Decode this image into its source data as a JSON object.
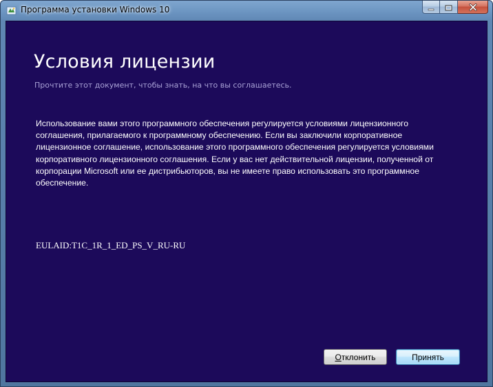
{
  "window": {
    "title": "Программа установки Windows 10"
  },
  "main": {
    "heading": "Условия лицензии",
    "subheading": "Прочтите этот документ, чтобы знать, на что вы соглашаетесь.",
    "license_lines": [
      "Использование вами этого программного обеспечения регулируется условиями лицензионного",
      "соглашения, прилагаемого к программному обеспечению. Если вы заключили корпоративное",
      "лицензионное соглашение, использование этого программного обеспечения регулируется условиями",
      "корпоративного лицензионного соглашения. Если у вас нет действительной лицензии, полученной от",
      "корпорации Microsoft или ее дистрибьюторов, вы не имеете право использовать это программное",
      "обеспечение."
    ],
    "eula_id": "EULAID:T1C_1R_1_ED_PS_V_RU-RU"
  },
  "buttons": {
    "decline_accel": "О",
    "decline_rest": "тклонить",
    "accept_label": "Принять"
  },
  "colors": {
    "client_background": "#1c0a5a",
    "heading": "#ffffff",
    "subheading": "#a9a2d6",
    "titlebar": "#6a93c0",
    "close_button": "#c4503c"
  },
  "icons": {
    "app": "windows-setup-icon",
    "minimize": "minimize-icon",
    "maximize": "maximize-icon",
    "close": "close-icon"
  }
}
